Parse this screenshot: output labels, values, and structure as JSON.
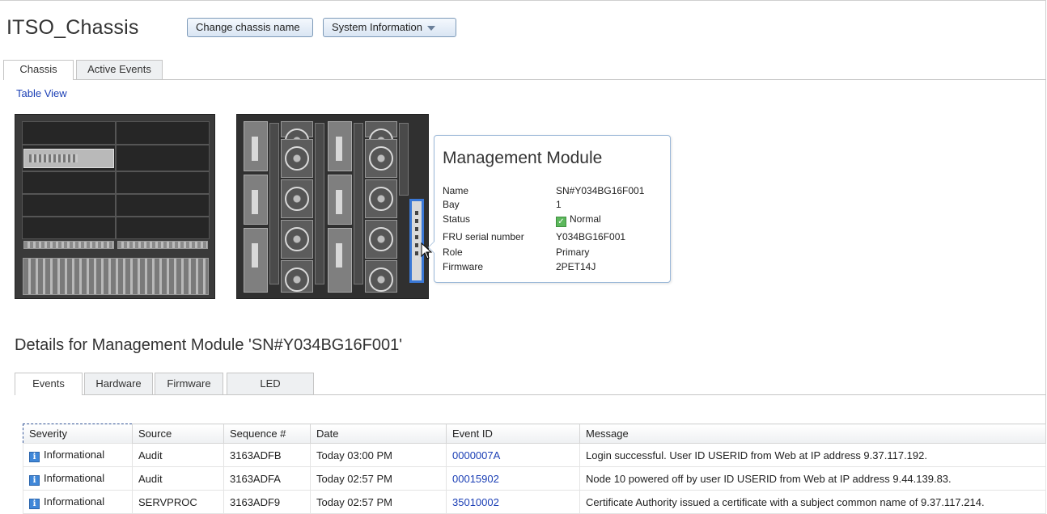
{
  "header": {
    "title": "ITSO_Chassis",
    "change_name_label": "Change chassis name",
    "system_info_label": "System Information"
  },
  "top_tabs": [
    {
      "label": "Chassis",
      "active": true
    },
    {
      "label": "Active Events",
      "active": false
    }
  ],
  "table_view_link": "Table View",
  "popup": {
    "title": "Management Module",
    "properties": [
      {
        "key": "Name",
        "value": "SN#Y034BG16F001"
      },
      {
        "key": "Bay",
        "value": "1"
      },
      {
        "key": "Status",
        "value": "Normal",
        "icon": "check-icon"
      },
      {
        "key": "FRU serial number",
        "value": "Y034BG16F001"
      },
      {
        "key": "Role",
        "value": "Primary"
      },
      {
        "key": "Firmware",
        "value": "2PET14J"
      }
    ]
  },
  "details": {
    "title": "Details for Management Module 'SN#Y034BG16F001'",
    "tabs": [
      {
        "label": "Events",
        "active": true
      },
      {
        "label": "Hardware",
        "active": false
      },
      {
        "label": "Firmware",
        "active": false
      },
      {
        "label": "LED",
        "active": false
      }
    ],
    "columns": [
      "Severity",
      "Source",
      "Sequence #",
      "Date",
      "Event ID",
      "Message"
    ],
    "rows": [
      {
        "severity": "Informational",
        "source": "Audit",
        "sequence": "3163ADFB",
        "date": "Today 03:00 PM",
        "event_id": "0000007A",
        "message": "Login successful. User ID USERID from Web at IP address 9.37.117.192."
      },
      {
        "severity": "Informational",
        "source": "Audit",
        "sequence": "3163ADFA",
        "date": "Today 02:57 PM",
        "event_id": "00015902",
        "message": "Node 10 powered off by user ID USERID from Web at IP address 9.44.139.83."
      },
      {
        "severity": "Informational",
        "source": "SERVPROC",
        "sequence": "3163ADF9",
        "date": "Today 02:57 PM",
        "event_id": "35010002",
        "message": "Certificate Authority issued a certificate with a subject common name of 9.37.117.214."
      }
    ]
  },
  "colors": {
    "link": "#1b3fb5",
    "selection_outline": "#3a78d6",
    "info_icon": "#3f87d8",
    "status_ok": "#5cb85c"
  }
}
